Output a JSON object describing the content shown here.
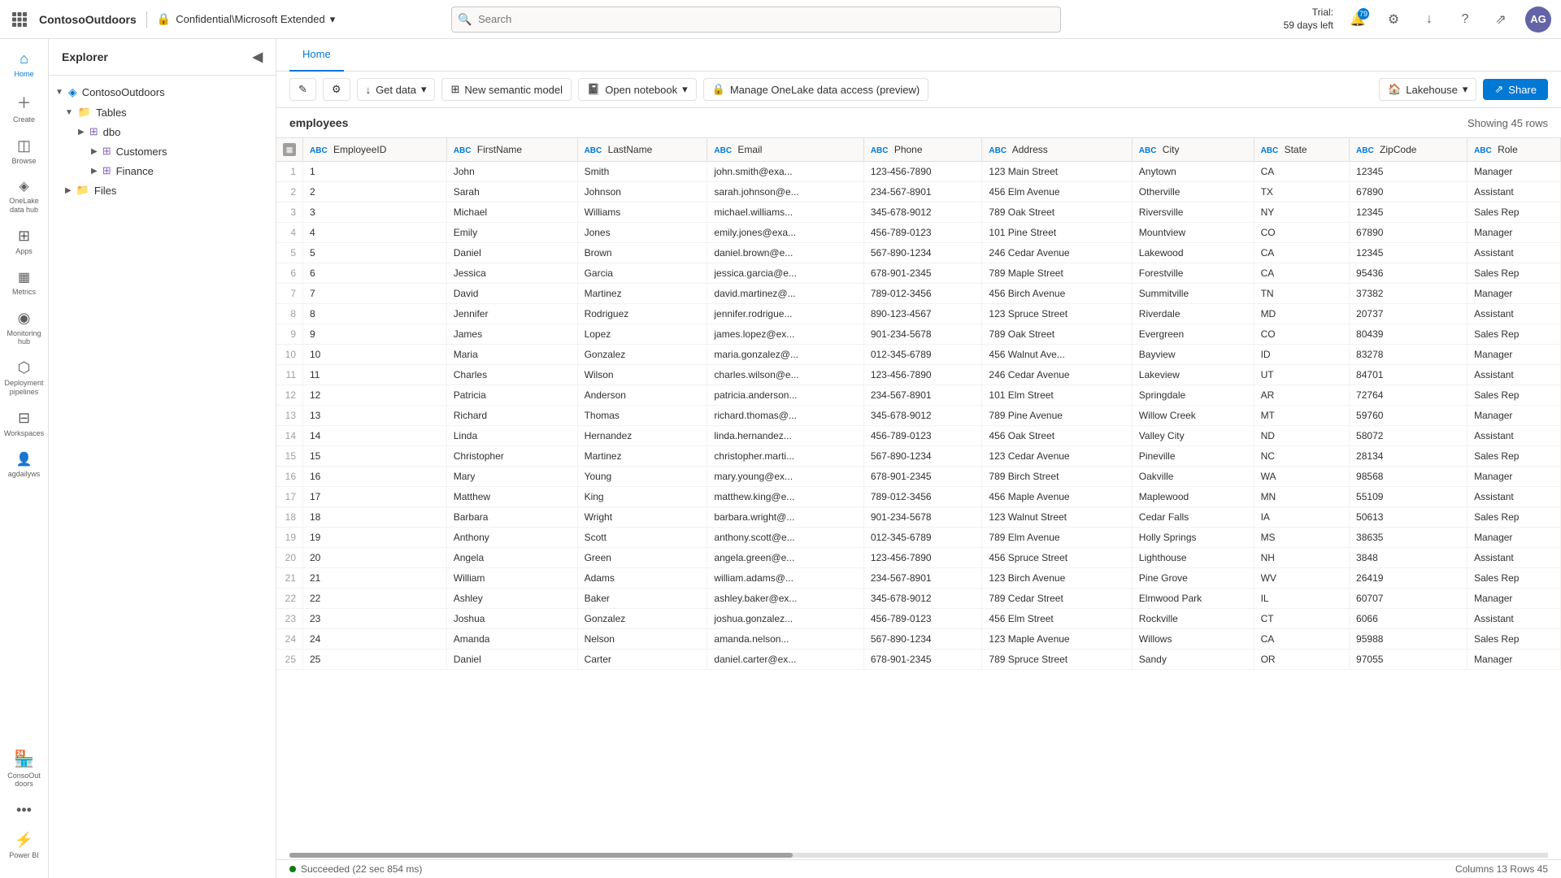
{
  "topbar": {
    "logo": "ContosoOutdoors",
    "divider": "|",
    "workspace_icon": "🔒",
    "workspace_label": "Confidential\\Microsoft Extended",
    "workspace_chevron": "▾",
    "search_placeholder": "Search",
    "trial_line1": "Trial:",
    "trial_line2": "59 days left",
    "notification_badge": "79",
    "avatar_initials": "AG"
  },
  "sidebar": {
    "items": [
      {
        "id": "home",
        "icon": "⌂",
        "label": "Home"
      },
      {
        "id": "create",
        "icon": "+",
        "label": "Create"
      },
      {
        "id": "browse",
        "icon": "◫",
        "label": "Browse"
      },
      {
        "id": "onelake",
        "icon": "◈",
        "label": "OneLake data hub"
      },
      {
        "id": "apps",
        "icon": "⊞",
        "label": "Apps"
      },
      {
        "id": "metrics",
        "icon": "▦",
        "label": "Metrics"
      },
      {
        "id": "monitoring",
        "icon": "◉",
        "label": "Monitoring hub"
      },
      {
        "id": "deployment",
        "icon": "⬡",
        "label": "Deployment pipelines"
      },
      {
        "id": "workspaces",
        "icon": "⊟",
        "label": "Workspaces"
      },
      {
        "id": "agdailyws",
        "icon": "👤",
        "label": "agdailyws"
      }
    ],
    "bottom_items": [
      {
        "id": "contoso",
        "icon": "🏪",
        "label": "ConsoOut doors"
      },
      {
        "id": "more",
        "icon": "…",
        "label": ""
      },
      {
        "id": "powerbi",
        "icon": "⚡",
        "label": "Power BI"
      }
    ]
  },
  "explorer": {
    "title": "Explorer",
    "tree": [
      {
        "level": 0,
        "icon": "▼",
        "type": "workspace",
        "label": "ContosoOutdoors",
        "expanded": true
      },
      {
        "level": 1,
        "icon": "▼",
        "type": "folder",
        "label": "Tables",
        "expanded": true
      },
      {
        "level": 2,
        "icon": "▶",
        "type": "schema",
        "label": "dbo",
        "expanded": true
      },
      {
        "level": 3,
        "icon": "▶",
        "type": "table",
        "label": "Customers",
        "expanded": false,
        "selected": false
      },
      {
        "level": 3,
        "icon": "▶",
        "type": "table",
        "label": "Finance",
        "expanded": false,
        "selected": false
      },
      {
        "level": 1,
        "icon": "▶",
        "type": "folder",
        "label": "Files",
        "expanded": false
      }
    ]
  },
  "tabs": [
    {
      "id": "home",
      "label": "Home",
      "active": true
    }
  ],
  "toolbar": {
    "edit_icon": "✎",
    "settings_icon": "⚙",
    "get_data_label": "Get data",
    "get_data_icon": "↓",
    "new_semantic_label": "New semantic model",
    "new_semantic_icon": "⊞",
    "open_notebook_label": "Open notebook",
    "open_notebook_icon": "📓",
    "manage_label": "Manage OneLake data access (preview)",
    "manage_icon": "🔒",
    "lakehouse_label": "Lakehouse",
    "lakehouse_icon": "🏠",
    "share_label": "Share"
  },
  "data": {
    "table_name": "employees",
    "row_count_label": "Showing 45 rows",
    "columns": [
      {
        "type": "ABC",
        "name": "EmployeeID"
      },
      {
        "type": "ABC",
        "name": "FirstName"
      },
      {
        "type": "ABC",
        "name": "LastName"
      },
      {
        "type": "ABC",
        "name": "Email"
      },
      {
        "type": "ABC",
        "name": "Phone"
      },
      {
        "type": "ABC",
        "name": "Address"
      },
      {
        "type": "ABC",
        "name": "City"
      },
      {
        "type": "ABC",
        "name": "State"
      },
      {
        "type": "ABC",
        "name": "ZipCode"
      },
      {
        "type": "ABC",
        "name": "Role"
      }
    ],
    "rows": [
      [
        1,
        1,
        "John",
        "Smith",
        "john.smith@exa...",
        "123-456-7890",
        "123 Main Street",
        "Anytown",
        "CA",
        "12345",
        "Manager"
      ],
      [
        2,
        2,
        "Sarah",
        "Johnson",
        "sarah.johnson@e...",
        "234-567-8901",
        "456 Elm Avenue",
        "Otherville",
        "TX",
        "67890",
        "Assistant"
      ],
      [
        3,
        3,
        "Michael",
        "Williams",
        "michael.williams...",
        "345-678-9012",
        "789 Oak Street",
        "Riversville",
        "NY",
        "12345",
        "Sales Rep"
      ],
      [
        4,
        4,
        "Emily",
        "Jones",
        "emily.jones@exa...",
        "456-789-0123",
        "101 Pine Street",
        "Mountview",
        "CO",
        "67890",
        "Manager"
      ],
      [
        5,
        5,
        "Daniel",
        "Brown",
        "daniel.brown@e...",
        "567-890-1234",
        "246 Cedar Avenue",
        "Lakewood",
        "CA",
        "12345",
        "Assistant"
      ],
      [
        6,
        6,
        "Jessica",
        "Garcia",
        "jessica.garcia@e...",
        "678-901-2345",
        "789 Maple Street",
        "Forestville",
        "CA",
        "95436",
        "Sales Rep"
      ],
      [
        7,
        7,
        "David",
        "Martinez",
        "david.martinez@...",
        "789-012-3456",
        "456 Birch Avenue",
        "Summitville",
        "TN",
        "37382",
        "Manager"
      ],
      [
        8,
        8,
        "Jennifer",
        "Rodriguez",
        "jennifer.rodrigue...",
        "890-123-4567",
        "123 Spruce Street",
        "Riverdale",
        "MD",
        "20737",
        "Assistant"
      ],
      [
        9,
        9,
        "James",
        "Lopez",
        "james.lopez@ex...",
        "901-234-5678",
        "789 Oak Street",
        "Evergreen",
        "CO",
        "80439",
        "Sales Rep"
      ],
      [
        10,
        10,
        "Maria",
        "Gonzalez",
        "maria.gonzalez@...",
        "012-345-6789",
        "456 Walnut Ave...",
        "Bayview",
        "ID",
        "83278",
        "Manager"
      ],
      [
        11,
        11,
        "Charles",
        "Wilson",
        "charles.wilson@e...",
        "123-456-7890",
        "246 Cedar Avenue",
        "Lakeview",
        "UT",
        "84701",
        "Assistant"
      ],
      [
        12,
        12,
        "Patricia",
        "Anderson",
        "patricia.anderson...",
        "234-567-8901",
        "101 Elm Street",
        "Springdale",
        "AR",
        "72764",
        "Sales Rep"
      ],
      [
        13,
        13,
        "Richard",
        "Thomas",
        "richard.thomas@...",
        "345-678-9012",
        "789 Pine Avenue",
        "Willow Creek",
        "MT",
        "59760",
        "Manager"
      ],
      [
        14,
        14,
        "Linda",
        "Hernandez",
        "linda.hernandez...",
        "456-789-0123",
        "456 Oak Street",
        "Valley City",
        "ND",
        "58072",
        "Assistant"
      ],
      [
        15,
        15,
        "Christopher",
        "Martinez",
        "christopher.marti...",
        "567-890-1234",
        "123 Cedar Avenue",
        "Pineville",
        "NC",
        "28134",
        "Sales Rep"
      ],
      [
        16,
        16,
        "Mary",
        "Young",
        "mary.young@ex...",
        "678-901-2345",
        "789 Birch Street",
        "Oakville",
        "WA",
        "98568",
        "Manager"
      ],
      [
        17,
        17,
        "Matthew",
        "King",
        "matthew.king@e...",
        "789-012-3456",
        "456 Maple Avenue",
        "Maplewood",
        "MN",
        "55109",
        "Assistant"
      ],
      [
        18,
        18,
        "Barbara",
        "Wright",
        "barbara.wright@...",
        "901-234-5678",
        "123 Walnut Street",
        "Cedar Falls",
        "IA",
        "50613",
        "Sales Rep"
      ],
      [
        19,
        19,
        "Anthony",
        "Scott",
        "anthony.scott@e...",
        "012-345-6789",
        "789 Elm Avenue",
        "Holly Springs",
        "MS",
        "38635",
        "Manager"
      ],
      [
        20,
        20,
        "Angela",
        "Green",
        "angela.green@e...",
        "123-456-7890",
        "456 Spruce Street",
        "Lighthouse",
        "NH",
        "3848",
        "Assistant"
      ],
      [
        21,
        21,
        "William",
        "Adams",
        "william.adams@...",
        "234-567-8901",
        "123 Birch Avenue",
        "Pine Grove",
        "WV",
        "26419",
        "Sales Rep"
      ],
      [
        22,
        22,
        "Ashley",
        "Baker",
        "ashley.baker@ex...",
        "345-678-9012",
        "789 Cedar Street",
        "Elmwood Park",
        "IL",
        "60707",
        "Manager"
      ],
      [
        23,
        23,
        "Joshua",
        "Gonzalez",
        "joshua.gonzalez...",
        "456-789-0123",
        "456 Elm Street",
        "Rockville",
        "CT",
        "6066",
        "Assistant"
      ],
      [
        24,
        24,
        "Amanda",
        "Nelson",
        "amanda.nelson...",
        "567-890-1234",
        "123 Maple Avenue",
        "Willows",
        "CA",
        "95988",
        "Sales Rep"
      ],
      [
        25,
        25,
        "Daniel",
        "Carter",
        "daniel.carter@ex...",
        "678-901-2345",
        "789 Spruce Street",
        "Sandy",
        "OR",
        "97055",
        "Manager"
      ]
    ]
  },
  "status_bar": {
    "ok_message": "Succeeded (22 sec 854 ms)",
    "columns_rows": "Columns 13 Rows 45"
  }
}
